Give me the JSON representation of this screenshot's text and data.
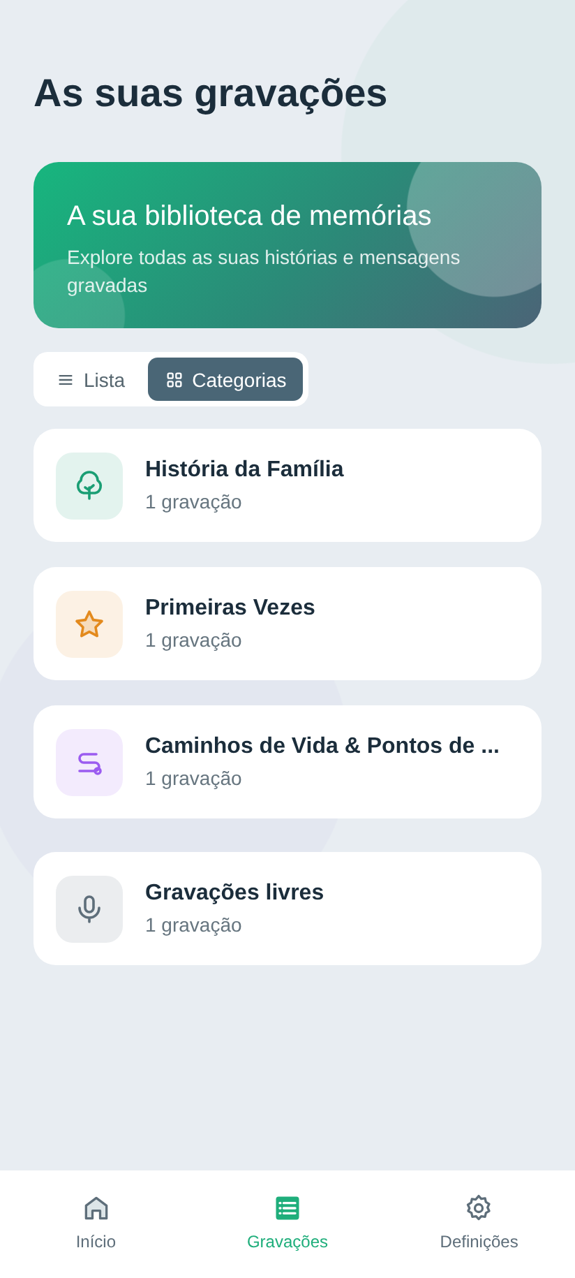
{
  "title": "As suas gravações",
  "hero": {
    "title": "A sua biblioteca de memórias",
    "subtitle": "Explore todas as suas histórias e mensagens gravadas"
  },
  "view_toggle": [
    {
      "label": "Lista",
      "kind": "list",
      "selected": false
    },
    {
      "label": "Categorias",
      "kind": "grid",
      "selected": true
    }
  ],
  "categories": [
    {
      "kind": "tree",
      "color": "#1a9e74",
      "name": "História da Família",
      "count": "1 gravação"
    },
    {
      "kind": "star",
      "color": "#e38a1d",
      "name": "Primeiras Vezes",
      "count": "1 gravação"
    },
    {
      "kind": "route",
      "color": "#9b5cf0",
      "name": "Caminhos de Vida & Pontos de ...",
      "count": "1 gravação"
    },
    {
      "kind": "mic",
      "color": "#5e6e7a",
      "name": "Gravações livres",
      "count": "1 gravação"
    }
  ],
  "bottom_nav": [
    {
      "label": "Início",
      "kind": "home",
      "selected": false
    },
    {
      "label": "Gravações",
      "kind": "list",
      "selected": true
    },
    {
      "label": "Definições",
      "kind": "gear",
      "selected": false
    }
  ]
}
